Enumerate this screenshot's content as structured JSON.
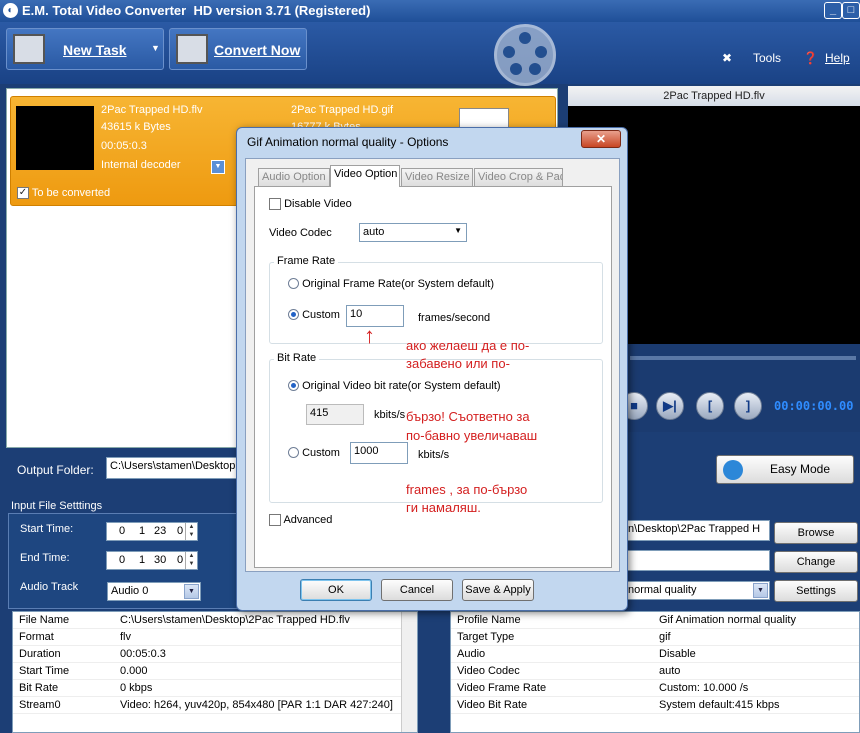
{
  "window": {
    "title": "E.M. Total Video Converter  HD version 3.71 (Registered)"
  },
  "toolbar": {
    "new_task": "New Task",
    "convert_now": "Convert Now",
    "tools": "Tools",
    "help": "Help"
  },
  "task": {
    "source_name": "2Pac Trapped HD.flv",
    "source_size": "43615 k Bytes",
    "source_duration": "00:05:0.3",
    "decoder": "Internal decoder",
    "to_be_converted": "To be converted",
    "output_name": "2Pac Trapped HD.gif",
    "output_size": "16777 k Bytes"
  },
  "preview": {
    "title": "2Pac Trapped HD.flv",
    "time": "00:00:00.00"
  },
  "output": {
    "folder_label": "Output Folder:",
    "folder_value": "C:\\Users\\stamen\\Desktop",
    "easy_mode": "Easy Mode"
  },
  "input_settings": {
    "header": "Input File Setttings",
    "start_time_label": "Start Time:",
    "start_time": [
      "0",
      "1",
      "23",
      "0"
    ],
    "end_time_label": "End Time:",
    "end_time": [
      "0",
      "1",
      "30",
      "0"
    ],
    "audio_track_label": "Audio Track",
    "audio_track": "Audio 0"
  },
  "output_settings": {
    "path_value": "n\\Desktop\\2Pac Trapped H",
    "browse": "Browse",
    "change": "Change",
    "profile_value": "normal quality",
    "settings": "Settings"
  },
  "input_info": [
    {
      "k": "File Name",
      "v": "C:\\Users\\stamen\\Desktop\\2Pac Trapped HD.flv"
    },
    {
      "k": "Format",
      "v": "flv"
    },
    {
      "k": "Duration",
      "v": "00:05:0.3"
    },
    {
      "k": "Start Time",
      "v": "0.000"
    },
    {
      "k": "Bit Rate",
      "v": "0 kbps"
    },
    {
      "k": "Stream0",
      "v": "Video: h264, yuv420p, 854x480 [PAR 1:1 DAR 427:240]"
    }
  ],
  "output_info": [
    {
      "k": "Profile Name",
      "v": "Gif Animation normal quality"
    },
    {
      "k": "Target Type",
      "v": "gif"
    },
    {
      "k": "Audio",
      "v": "Disable"
    },
    {
      "k": "Video Codec",
      "v": "auto"
    },
    {
      "k": "Video Frame Rate",
      "v": "Custom: 10.000 /s"
    },
    {
      "k": "Video Bit Rate",
      "v": "System default:415 kbps"
    }
  ],
  "dialog": {
    "title": "Gif Animation normal quality - Options",
    "tabs": [
      "Audio Option",
      "Video Option",
      "Video Resize",
      "Video Crop & Pad"
    ],
    "disable_video": "Disable Video",
    "video_codec_label": "Video Codec",
    "video_codec": "auto",
    "frame_rate_group": "Frame Rate",
    "original_frame_rate": "Original Frame Rate(or System default)",
    "custom": "Custom",
    "fps_value": "10",
    "fps_unit": "frames/second",
    "bit_rate_group": "Bit Rate",
    "original_bit_rate": "Original Video bit rate(or System default)",
    "bit_rate_default": "415",
    "kbits_unit1": "kbits/s",
    "custom_bit_rate": "1000",
    "kbits_unit2": "kbits/s",
    "advanced": "Advanced",
    "ok": "OK",
    "cancel": "Cancel",
    "save_apply": "Save & Apply"
  },
  "annotations": {
    "line1": "ако желаеш да е  по-",
    "line2": "забавено или по-",
    "line3": "бързо! Съответно за",
    "line4": "по-бавно увеличаваш",
    "line5": "frames , за по-бързо",
    "line6": "ги намаляш."
  }
}
